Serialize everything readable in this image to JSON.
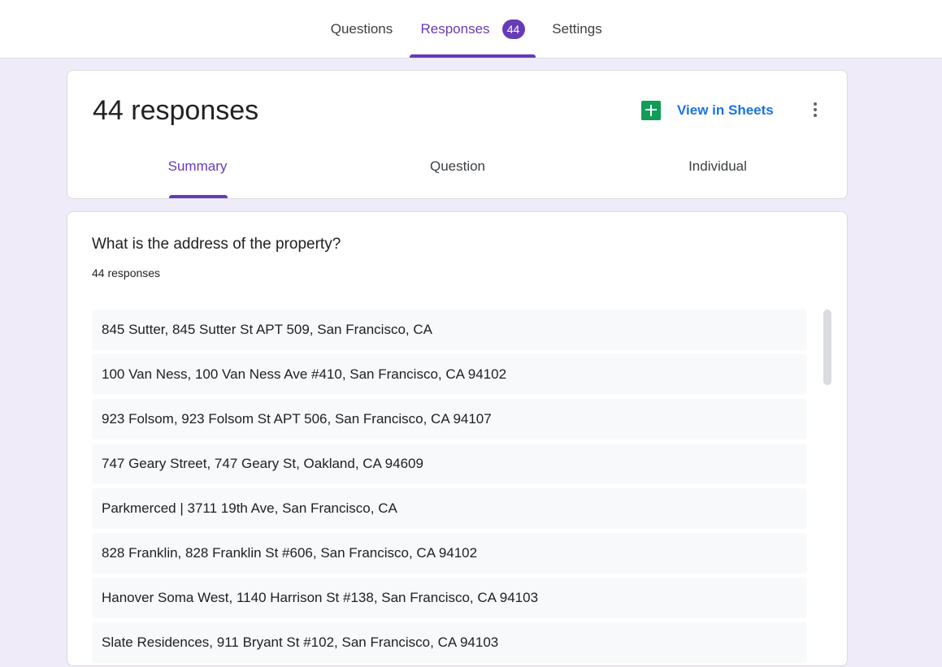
{
  "top_tabs": [
    {
      "label": "Questions"
    },
    {
      "label": "Responses",
      "badge": "44"
    },
    {
      "label": "Settings"
    }
  ],
  "header": {
    "title": "44 responses",
    "sheets_label": "View in Sheets",
    "sheets_icon": "google-sheets-icon",
    "more_icon": "more-vert-icon"
  },
  "sub_tabs": [
    {
      "label": "Summary"
    },
    {
      "label": "Question"
    },
    {
      "label": "Individual"
    }
  ],
  "question": {
    "title": "What is the address of the property?",
    "count": "44 responses",
    "responses": [
      "845 Sutter, 845 Sutter St APT 509, San Francisco, CA",
      "100 Van Ness, 100 Van Ness Ave #410, San Francisco, CA 94102",
      "923 Folsom, 923 Folsom St APT 506, San Francisco, CA 94107",
      "747 Geary Street, 747 Geary St, Oakland, CA 94609",
      "Parkmerced | 3711 19th Ave, San Francisco, CA",
      "828 Franklin, 828 Franklin St #606, San Francisco, CA 94102",
      "Hanover Soma West, 1140 Harrison St #138, San Francisco, CA 94103",
      "Slate Residences, 911 Bryant St #102, San Francisco, CA 94103"
    ]
  },
  "colors": {
    "accent": "#673ab7",
    "link": "#1a73e8",
    "sheets_green": "#0f9d58",
    "page_bg": "#f0ebf8"
  }
}
